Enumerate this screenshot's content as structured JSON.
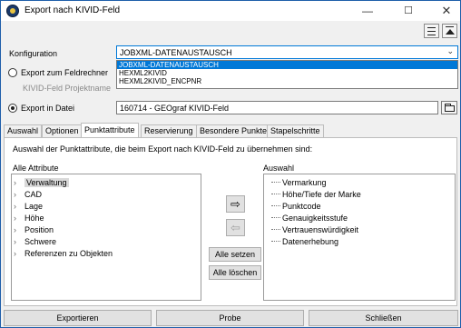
{
  "window": {
    "title": "Export nach KIVID-Feld",
    "minimize_icon": "minimize-icon",
    "maximize_icon": "maximize-icon",
    "close_icon": "close-icon",
    "border_color": "#1f5faa"
  },
  "toolbar": {
    "list_icon": "list-lines-icon",
    "top_icon": "move-to-top-icon"
  },
  "konfiguration": {
    "label": "Konfiguration",
    "value": "JOBXML-DATENAUSTAUSCH",
    "options": [
      "JOBXML-DATENAUSTAUSCH",
      "HEXML2KIVID",
      "HEXML2KIVID_ENCPNR"
    ],
    "selected_index": 0,
    "highlight_color": "#0078d7"
  },
  "export_feldrechner": {
    "label": "Export zum Feldrechner",
    "checked": false,
    "projektname_label": "KIVID-Feld Projektname"
  },
  "export_datei": {
    "label": "Export in Datei",
    "checked": true,
    "value": "160714 - GEOgraf KIVID-Feld",
    "folder_icon": "folder-icon"
  },
  "tabs": [
    {
      "label": "Auswahl",
      "active": false
    },
    {
      "label": "Optionen",
      "active": false
    },
    {
      "label": "Punktattribute",
      "active": true
    },
    {
      "label": "Reservierung",
      "active": false
    },
    {
      "label": "Besondere Punkte",
      "active": false
    },
    {
      "label": "Stapelschritte",
      "active": false
    }
  ],
  "punktattribute": {
    "instruction": "Auswahl der Punktattribute, die beim Export nach KIVID-Feld zu übernehmen sind:",
    "alle_attribute_label": "Alle Attribute",
    "auswahl_label": "Auswahl",
    "alle_attribute": [
      "Verwaltung",
      "CAD",
      "Lage",
      "Höhe",
      "Position",
      "Schwere",
      "Referenzen zu Objekten"
    ],
    "auswahl": [
      "Vermarkung",
      "Höhe/Tiefe der Marke",
      "Punktcode",
      "Genauigkeitsstufe",
      "Vertrauenswürdigkeit",
      "Datenerhebung"
    ],
    "add_icon": "arrow-right-icon",
    "remove_icon": "arrow-left-icon",
    "alle_setzen": "Alle setzen",
    "alle_loeschen": "Alle löschen"
  },
  "buttons": {
    "exportieren": "Exportieren",
    "probe": "Probe",
    "schliessen": "Schließen"
  }
}
